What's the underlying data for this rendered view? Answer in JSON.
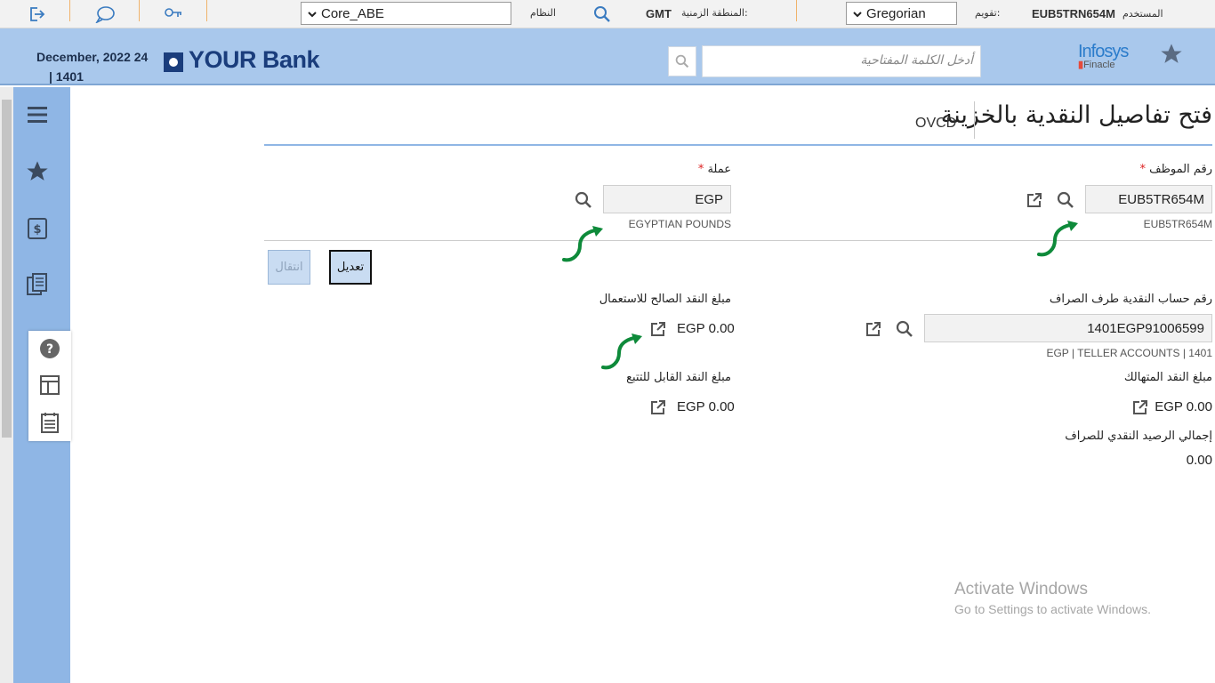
{
  "topbar": {
    "user_label": "المستخدم",
    "user_id": "EUB5TRN654M",
    "calendar_label": "تقويم:",
    "calendar_value": "Gregorian",
    "timezone_label": "المنطقة الزمنية:",
    "timezone_value": "GMT",
    "system_label": "النظام",
    "system_value": "Core_ABE"
  },
  "header": {
    "date": "December, 2022 24",
    "date_sub": "| 1401",
    "bank_name": "YOUR Bank",
    "search_placeholder": "أدخل الكلمة المفتاحية",
    "vendor_top": "Infosys",
    "vendor_bottom": "Finacle"
  },
  "page": {
    "title": "فتح تفاصيل النقدية بالخزينة",
    "code": "OVCD"
  },
  "form": {
    "employee": {
      "label": "رقم الموظف",
      "required": "*",
      "value": "EUB5TR654M",
      "sub": "EUB5TR654M"
    },
    "currency": {
      "label": "عملة",
      "required": "*",
      "value": "EGP",
      "sub": "EGYPTIAN POUNDS"
    },
    "buttons": {
      "edit": "تعديل",
      "move": "انتقال"
    },
    "teller_account": {
      "label": "رقم حساب النقدية طرف الصراف",
      "value": "1401EGP91006599",
      "sub": "EGP | TELLER ACCOUNTS | 1401"
    },
    "usable_cash": {
      "label": "مبلغ النقد الصالح للاستعمال",
      "value": "EGP 0.00"
    },
    "worn_cash": {
      "label": "مبلغ النقد المتهالك",
      "value": "EGP 0.00"
    },
    "traceable_cash": {
      "label": "مبلغ النقد القابل للتتبع",
      "value": "EGP 0.00"
    },
    "teller_total": {
      "label": "إجمالي الرصيد النقدي للصراف",
      "value": "0.00"
    }
  },
  "watermark": {
    "line1": "Activate Windows",
    "line2": "Go to Settings to activate Windows."
  },
  "colors": {
    "header_bg": "#a9c8ec",
    "sidebar_bg": "#8fb6e5",
    "brand": "#1a3d7c",
    "accent_icon": "#3a7bc0",
    "annotation_arrow": "#0e8a3a"
  },
  "icons": [
    "logout-icon",
    "chat-icon",
    "key-icon",
    "search-icon",
    "star-icon",
    "menu-icon",
    "currency-exchange-icon",
    "documents-icon",
    "help-icon",
    "layout-icon",
    "calendar-icon",
    "external-link-icon"
  ]
}
